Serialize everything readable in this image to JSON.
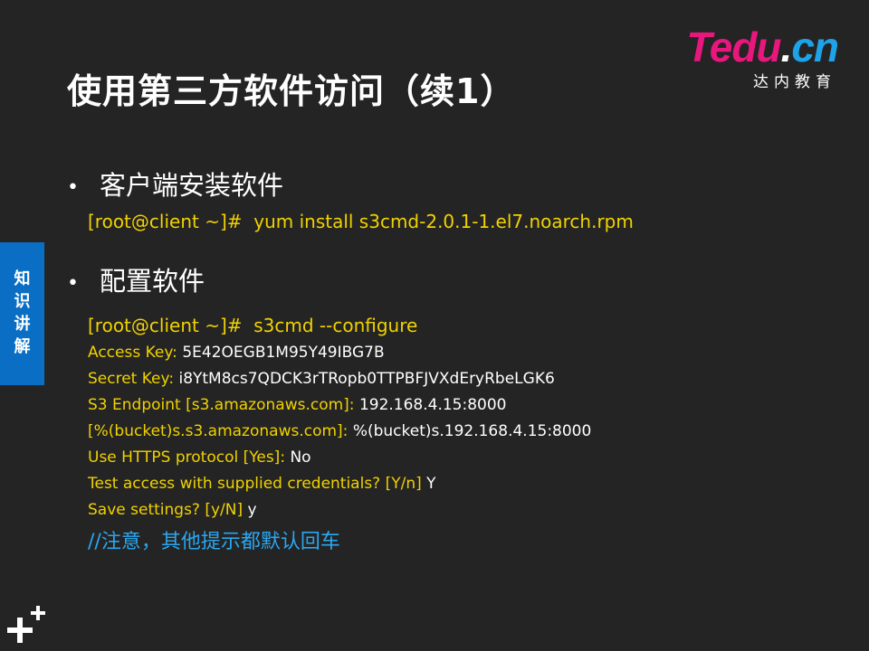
{
  "logo": {
    "mark_t": "T",
    "mark_rest": "edu",
    "mark_dot": ".",
    "mark_cn": "cn",
    "subtitle": "达内教育"
  },
  "title": "使用第三方软件访问（续1）",
  "side_tab": {
    "label": "知识讲解"
  },
  "bullets": [
    {
      "text": "客户端安装软件"
    },
    {
      "text": "配置软件"
    }
  ],
  "install_cmd": {
    "prompt": "[root@client ~]#",
    "command": "yum install s3cmd-2.0.1-1.el7.noarch.rpm"
  },
  "configure_cmd": {
    "prompt": "[root@client ~]#",
    "command": "s3cmd --configure"
  },
  "config_lines": [
    {
      "label": "Access Key:",
      "value": "5E42OEGB1M95Y49IBG7B"
    },
    {
      "label": "Secret Key:",
      "value": "i8YtM8cs7QDCK3rTRopb0TTPBFJVXdEryRbeLGK6"
    },
    {
      "label": "S3 Endpoint [s3.amazonaws.com]:",
      "value": "192.168.4.15:8000"
    },
    {
      "label": "[%(bucket)s.s3.amazonaws.com]:",
      "value": "%(bucket)s.192.168.4.15:8000"
    },
    {
      "label": "Use HTTPS protocol [Yes]:",
      "value": "No"
    },
    {
      "label": "Test access with supplied credentials? [Y/n]",
      "value": "Y"
    },
    {
      "label": "Save settings? [y/N]",
      "value": "y"
    }
  ],
  "note": "//注意，其他提示都默认回车",
  "colors": {
    "background": "#242424",
    "prompt_yellow": "#f0d200",
    "note_blue": "#2aa7ef",
    "side_tab_blue": "#0a6fc4",
    "logo_pink": "#e8177d"
  },
  "icons": {
    "bottom_logo": "plus-plus-icon",
    "bullet": "bullet-dot-icon"
  }
}
